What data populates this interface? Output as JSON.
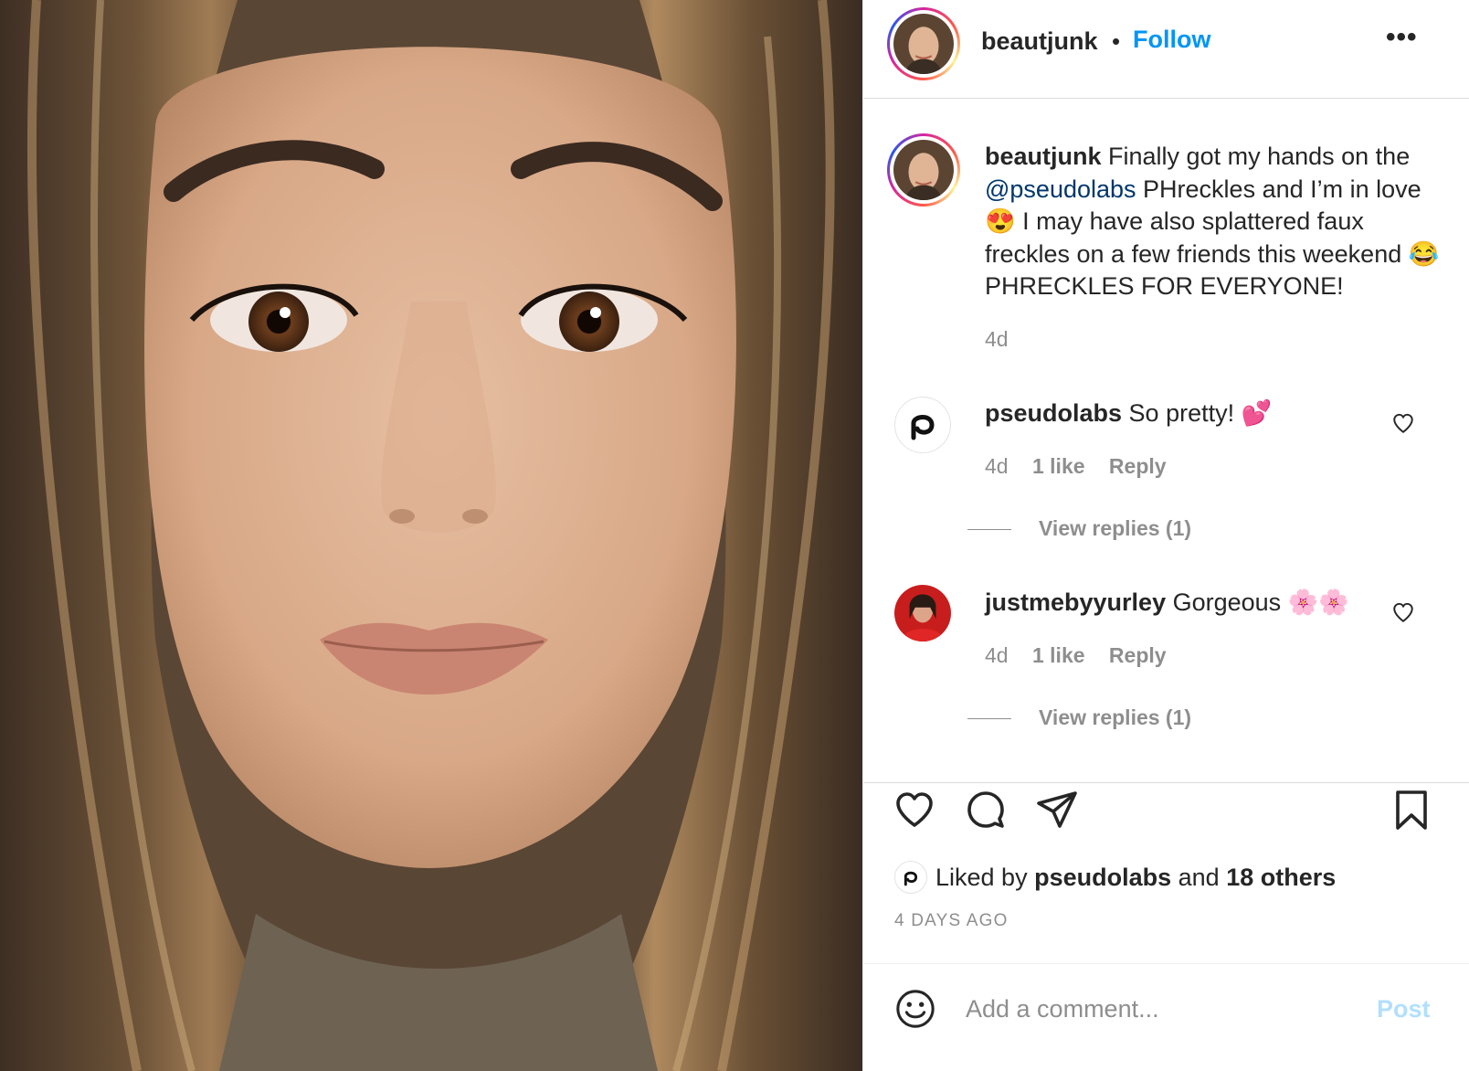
{
  "header": {
    "username": "beautjunk",
    "separator": "•",
    "follow_label": "Follow",
    "more_label": "•••"
  },
  "caption": {
    "username": "beautjunk",
    "text_1": "Finally got my hands on the",
    "mention": "@pseudolabs",
    "text_2": "PHreckles and I’m in love",
    "emoji_1": "😍",
    "text_3": "I may have also splattered faux freckles on a few friends this weekend",
    "emoji_2": "😂",
    "text_4": "PHRECKLES FOR EVERYONE!",
    "age": "4d"
  },
  "comments": [
    {
      "username": "pseudolabs",
      "text": "So pretty!",
      "emoji": "💕",
      "age": "4d",
      "likes": "1 like",
      "reply_label": "Reply",
      "view_replies": "View replies (1)"
    },
    {
      "username": "justmebyyurley",
      "text": "Gorgeous",
      "emoji": "🌸🌸",
      "age": "4d",
      "likes": "1 like",
      "reply_label": "Reply",
      "view_replies": "View replies (1)"
    }
  ],
  "likes": {
    "prefix": "Liked by",
    "user": "pseudolabs",
    "middle": "and",
    "others": "18 others"
  },
  "post_date": "4 DAYS AGO",
  "composer": {
    "placeholder": "Add a comment...",
    "post_label": "Post"
  },
  "icons": {
    "like": "heart-icon",
    "comment": "comment-bubble-icon",
    "share": "paper-plane-icon",
    "save": "bookmark-icon",
    "emoji": "smiley-icon",
    "more": "more-horizontal-icon"
  },
  "colors": {
    "accent": "#0095f6",
    "mention": "#00376b",
    "muted": "#8e8e8e",
    "post_disabled": "#b2dffc"
  }
}
